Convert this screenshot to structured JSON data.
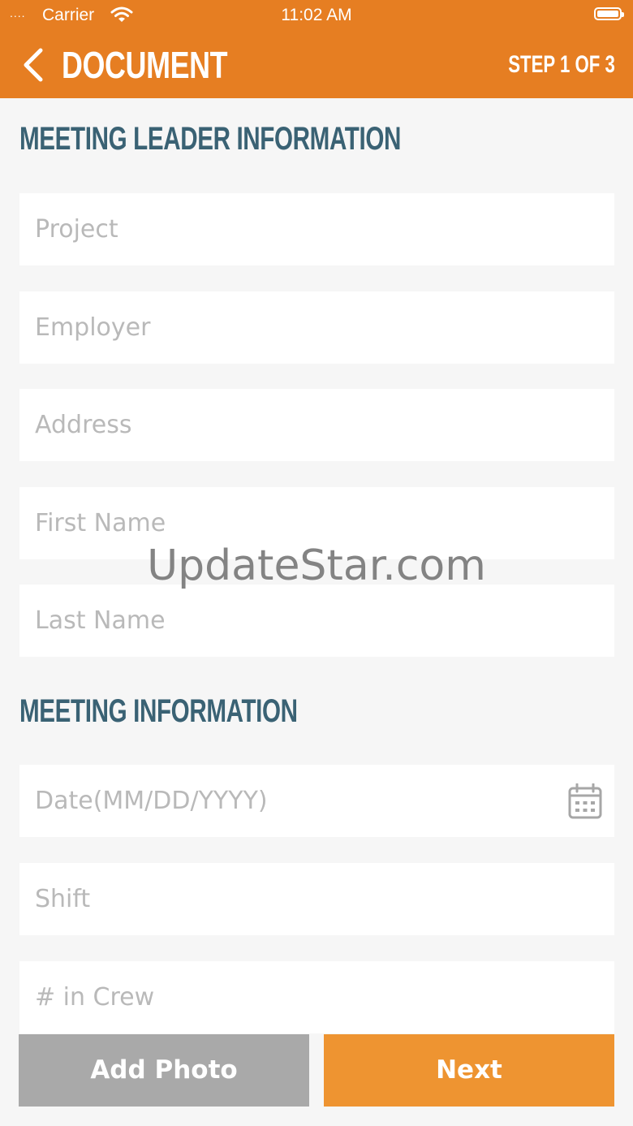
{
  "status_bar": {
    "signal": "....",
    "carrier": "Carrier",
    "time": "11:02 AM"
  },
  "nav": {
    "title": "DOCUMENT",
    "step": "STEP 1 OF 3"
  },
  "sections": {
    "leader": {
      "heading": "MEETING LEADER INFORMATION",
      "fields": {
        "project": "Project",
        "employer": "Employer",
        "address": "Address",
        "first_name": "First Name",
        "last_name": "Last Name"
      }
    },
    "meeting": {
      "heading": "MEETING INFORMATION",
      "fields": {
        "date": "Date(MM/DD/YYYY)",
        "shift": "Shift",
        "crew": "# in Crew"
      }
    }
  },
  "watermark": "UpdateStar.com",
  "buttons": {
    "add_photo": "Add Photo",
    "next": "Next"
  },
  "icons": [
    "wifi-icon",
    "battery-icon",
    "back-chevron-icon",
    "calendar-icon"
  ],
  "colors": {
    "accent": "#e67e22",
    "heading": "#3a6274",
    "next_button": "#ee9431",
    "photo_button": "#a9a9a9"
  }
}
